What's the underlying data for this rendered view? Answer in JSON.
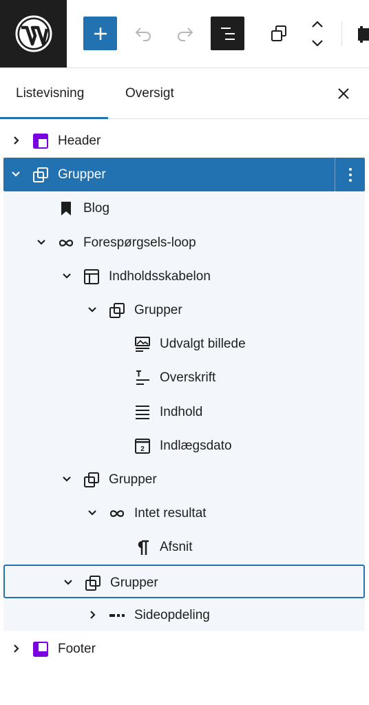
{
  "toolbar": {
    "wp_logo_icon": "wordpress-icon",
    "add_icon": "plus-icon",
    "undo_icon": "undo-icon",
    "redo_icon": "redo-icon",
    "list_view_icon": "list-view-icon",
    "duplicate_icon": "duplicate-icon",
    "move_icon": "chevron-up-down-icon",
    "extra_icon": "pin-icon",
    "accent_color": "#2271b1"
  },
  "panel": {
    "tabs": [
      {
        "label": "Listevisning",
        "active": true
      },
      {
        "label": "Oversigt",
        "active": false
      }
    ],
    "close_icon": "close-icon"
  },
  "tree": [
    {
      "label": "Header",
      "icon": "template-part-header-icon",
      "expanded": false,
      "level": 1
    },
    {
      "label": "Grupper",
      "icon": "group-icon",
      "expanded": true,
      "level": 1,
      "selected": true
    },
    {
      "label": "Blog",
      "icon": "bookmark-icon",
      "level": 2
    },
    {
      "label": "Forespørgsels-loop",
      "icon": "loop-icon",
      "expanded": true,
      "level": 2
    },
    {
      "label": "Indholdsskabelon",
      "icon": "layout-icon",
      "expanded": true,
      "level": 3
    },
    {
      "label": "Grupper",
      "icon": "group-icon",
      "expanded": true,
      "level": 4
    },
    {
      "label": "Udvalgt billede",
      "icon": "featured-image-icon",
      "level": 5
    },
    {
      "label": "Overskrift",
      "icon": "post-title-icon",
      "level": 5
    },
    {
      "label": "Indhold",
      "icon": "post-content-icon",
      "level": 5
    },
    {
      "label": "Indlægsdato",
      "icon": "post-date-icon",
      "level": 5
    },
    {
      "label": "Grupper",
      "icon": "group-icon",
      "expanded": true,
      "level": 3
    },
    {
      "label": "Intet resultat",
      "icon": "loop-icon",
      "expanded": true,
      "level": 4
    },
    {
      "label": "Afsnit",
      "icon": "paragraph-icon",
      "level": 5
    },
    {
      "label": "Grupper",
      "icon": "group-icon",
      "expanded": true,
      "level": 3,
      "focused": true
    },
    {
      "label": "Sideopdeling",
      "icon": "pagination-icon",
      "expanded": false,
      "level": 4
    },
    {
      "label": "Footer",
      "icon": "template-part-footer-icon",
      "expanded": false,
      "level": 1
    }
  ],
  "options_icon": "more-vertical-icon",
  "template_part_color": "#7a00df"
}
